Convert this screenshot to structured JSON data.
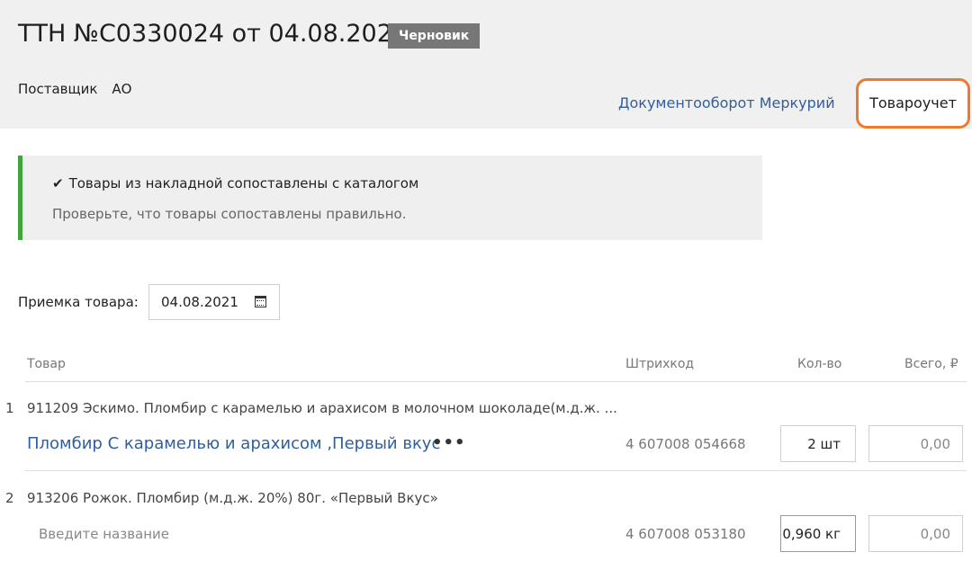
{
  "header": {
    "title": "ТТН №C0330024 от 04.08.2021",
    "status_badge": "Черновик",
    "supplier_label": "Поставщик",
    "supplier_value": "АО",
    "mercury_link": "Документооборот Меркурий",
    "tab_tovaroucher": "Товароучет"
  },
  "notice": {
    "icon": "check-icon",
    "title": "Товары из накладной сопоставлены с каталогом",
    "text": "Проверьте, что товары сопоставлены правильно.",
    "accent_color": "#41a53d"
  },
  "receiving": {
    "label": "Приемка товара:",
    "date": "04.08.2021",
    "icon": "calendar-icon"
  },
  "table": {
    "columns": {
      "product": "Товар",
      "barcode": "Штрихкод",
      "qty": "Кол-во",
      "total": "Всего, ₽"
    },
    "rows": [
      {
        "num": "1",
        "name": "911209 Эскимо. Пломбир с карамелью и арахисом в молочном шоколаде(м.д.ж. ...",
        "matched_name": "Пломбир С карамелью и арахисом ,Первый вкус",
        "more": "•••",
        "barcode": "4 607008 054668",
        "qty": "2 шт",
        "total": "0,00"
      },
      {
        "num": "2",
        "name": "913206 Рожок. Пломбир (м.д.ж. 20%) 80г. «Первый Вкус»",
        "name_placeholder": "Введите название",
        "barcode": "4 607008 053180",
        "qty": "0,960 кг",
        "total": "0,00"
      }
    ]
  },
  "colors": {
    "highlight_border": "#ee7a2e",
    "link": "#2f5f9e",
    "badge_bg": "#777777"
  }
}
